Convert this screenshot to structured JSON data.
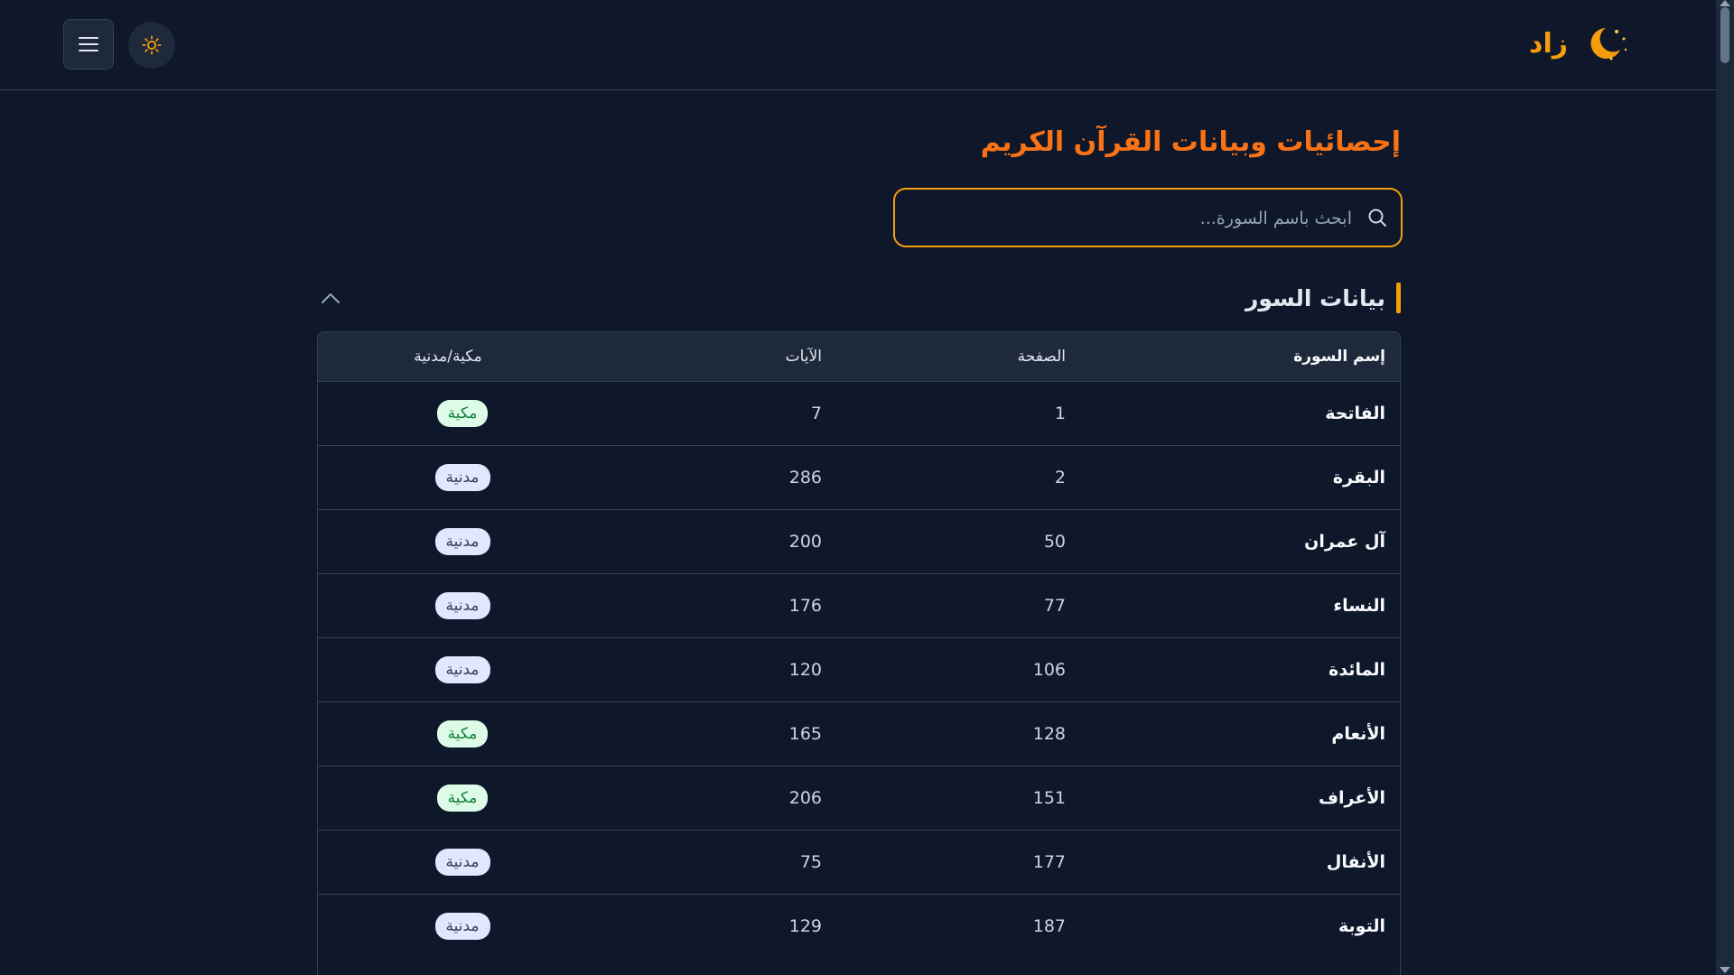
{
  "header": {
    "brand_name": "زاد",
    "brand_icon": "crescent-moon-icon",
    "menu_icon": "hamburger-menu-icon",
    "theme_icon": "sun-icon",
    "accent_color": "#f59e0b"
  },
  "page": {
    "title": "إحصائيات وبيانات القرآن الكريم",
    "search_placeholder": "ابحث باسم السورة...",
    "search_value": ""
  },
  "section": {
    "title": "بيانات السور",
    "collapse_icon": "chevron-up-icon"
  },
  "table": {
    "columns": [
      "إسم السورة",
      "الصفحة",
      "الآيات",
      "مكية/مدنية"
    ],
    "rows": [
      {
        "name": "الفاتحة",
        "page": "1",
        "ayat": "7",
        "type": "مكية",
        "kind": "makki"
      },
      {
        "name": "البقرة",
        "page": "2",
        "ayat": "286",
        "type": "مدنية",
        "kind": "madani"
      },
      {
        "name": "آل عمران",
        "page": "50",
        "ayat": "200",
        "type": "مدنية",
        "kind": "madani"
      },
      {
        "name": "النساء",
        "page": "77",
        "ayat": "176",
        "type": "مدنية",
        "kind": "madani"
      },
      {
        "name": "المائدة",
        "page": "106",
        "ayat": "120",
        "type": "مدنية",
        "kind": "madani"
      },
      {
        "name": "الأنعام",
        "page": "128",
        "ayat": "165",
        "type": "مكية",
        "kind": "makki"
      },
      {
        "name": "الأعراف",
        "page": "151",
        "ayat": "206",
        "type": "مكية",
        "kind": "makki"
      },
      {
        "name": "الأنفال",
        "page": "177",
        "ayat": "75",
        "type": "مدنية",
        "kind": "madani"
      },
      {
        "name": "التوبة",
        "page": "187",
        "ayat": "129",
        "type": "مدنية",
        "kind": "madani"
      }
    ]
  }
}
